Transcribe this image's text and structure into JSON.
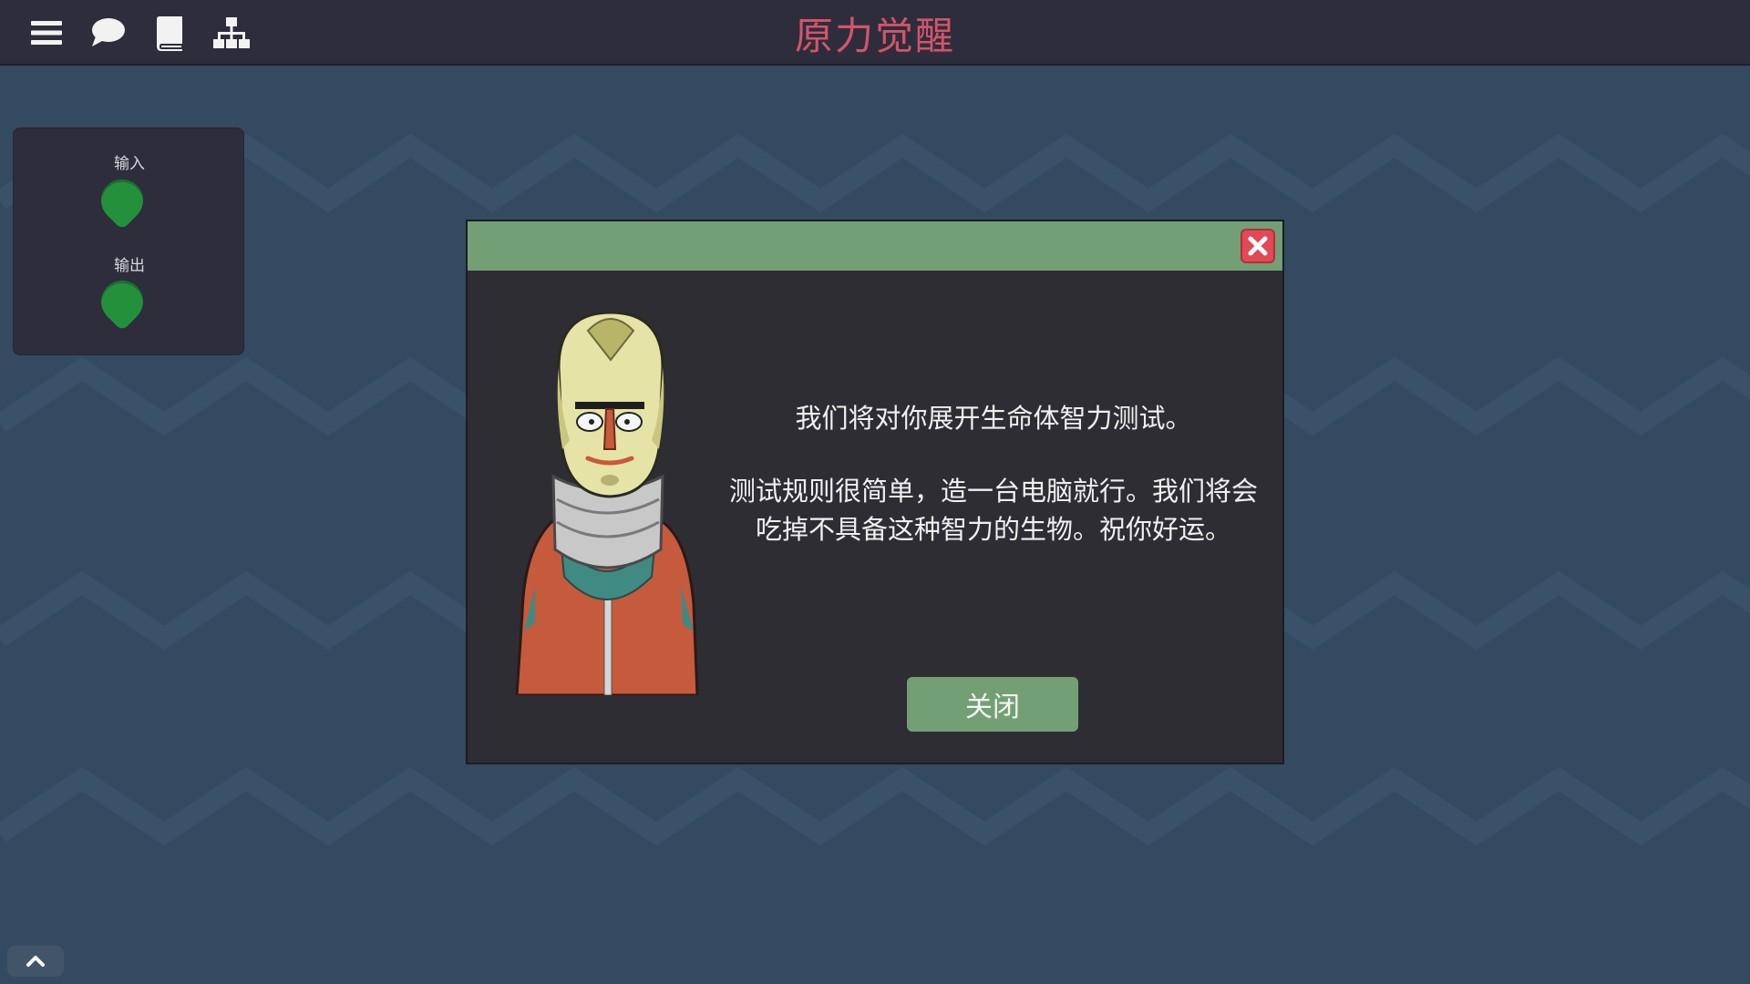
{
  "header": {
    "title": "原力觉醒",
    "tools": [
      {
        "icon": "menu-icon"
      },
      {
        "icon": "chat-icon"
      },
      {
        "icon": "book-icon"
      },
      {
        "icon": "hierarchy-icon"
      }
    ]
  },
  "io_panel": {
    "input_label": "输入",
    "output_label": "输出"
  },
  "dialog": {
    "line1": "我们将对你展开生命体智力测试。",
    "line2": "测试规则很简单，造一台电脑就行。我们将会",
    "line3": "吃掉不具备这种智力的生物。祝你好运。",
    "close_button": "关闭",
    "close_icon": "close-icon"
  },
  "colors": {
    "background": "#344a60",
    "topbar": "#2e2d3b",
    "title": "#d3546a",
    "accent_green": "#72a074",
    "pin_green": "#23913b",
    "close_red": "#e34857"
  }
}
